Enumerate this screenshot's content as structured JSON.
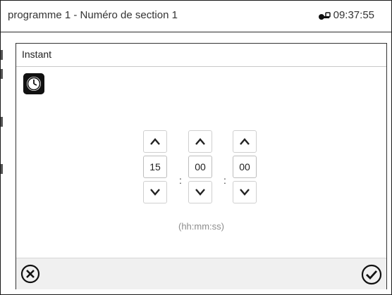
{
  "header": {
    "title": "programme 1 - Numéro de section 1",
    "time": "09:37:55",
    "lock_icon": "lock-key-icon"
  },
  "dialog": {
    "title": "Instant",
    "clock_icon": "clock-icon",
    "time_parts": [
      {
        "name": "hours",
        "value": "15"
      },
      {
        "name": "minutes",
        "value": "00"
      },
      {
        "name": "seconds",
        "value": "00"
      }
    ],
    "separator": ":",
    "format_hint": "(hh:mm:ss)",
    "cancel_icon": "cancel-circle-x-icon",
    "confirm_icon": "confirm-checkmark-icon"
  },
  "colors": {
    "frame": "#1a1a1a",
    "footer_bg": "#f0f0f0",
    "hint": "#8c8c8c"
  }
}
